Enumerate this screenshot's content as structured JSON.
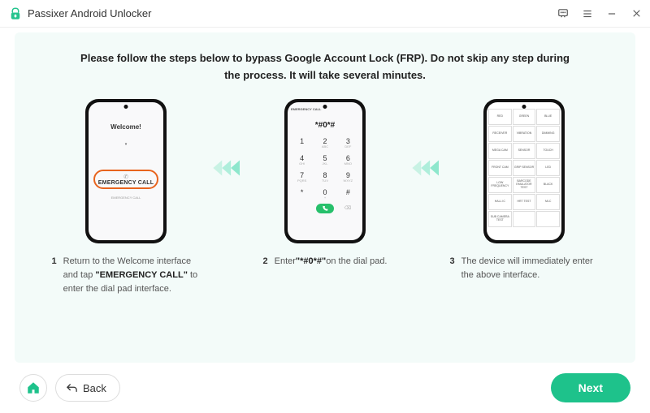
{
  "app": {
    "title": "Passixer Android Unlocker"
  },
  "heading": "Please follow the steps below to bypass Google Account Lock (FRP). Do not skip any step during the process. It will take several minutes.",
  "phone1": {
    "welcome": "Welcome!",
    "lang_hint": "▾",
    "emergency_label": "EMERGENCY CALL",
    "sub_label": "EMERGENCY CALL"
  },
  "phone2": {
    "header": "EMERGENCY CALL",
    "display": "*#0*#",
    "keys": [
      "1",
      "2",
      "3",
      "4",
      "5",
      "6",
      "7",
      "8",
      "9",
      "*",
      "0",
      "#"
    ],
    "subs": [
      "",
      "ABC",
      "DEF",
      "GHI",
      "JKL",
      "MNO",
      "PQRS",
      "TUV",
      "WXYZ",
      "",
      "+",
      ""
    ]
  },
  "phone3": {
    "cells": [
      "RED",
      "GREEN",
      "BLUE",
      "RECEIVER",
      "VIBRATION",
      "DIMMING",
      "MEGA CAM",
      "SENSOR",
      "TOUCH",
      "FRONT CAM",
      "GRIP SENSOR",
      "LED",
      "LOW FREQUENCY",
      "BARCODE EMULATOR TEST",
      "BLACK",
      "HALL IC",
      "HRT TEST",
      "MLC",
      "SUB CAMERA TEST",
      "",
      ""
    ]
  },
  "steps": {
    "s1": {
      "num": "1",
      "pre": "Return to the Welcome interface and tap ",
      "bold": "\"EMERGENCY CALL\"",
      "post": " to enter the dial pad interface."
    },
    "s2": {
      "num": "2",
      "pre": "Enter",
      "bold": "\"*#0*#\"",
      "post": "on the dial pad."
    },
    "s3": {
      "num": "3",
      "text": "The device will immediately enter the above interface."
    }
  },
  "footer": {
    "back": "Back",
    "next": "Next"
  }
}
